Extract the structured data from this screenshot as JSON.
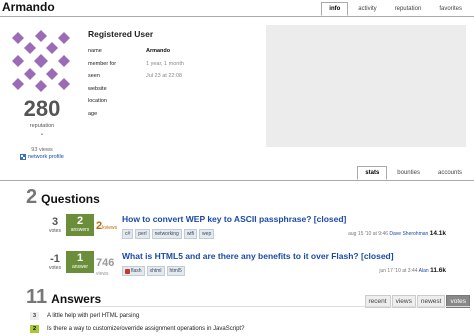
{
  "profile": {
    "name": "Armando",
    "registered": "Registered User",
    "reputation": "280",
    "reputation_label": "reputation",
    "rep_dot": "•",
    "views": "93 views",
    "network_profile": "network profile",
    "info": [
      {
        "key": "name",
        "value": "Armando",
        "bold": true
      },
      {
        "key": "member for",
        "value": "1 year, 1 month",
        "bold": false
      },
      {
        "key": "seen",
        "value": "Jul 23 at 22:08",
        "bold": false
      },
      {
        "key": "website",
        "value": "",
        "bold": false
      },
      {
        "key": "location",
        "value": "",
        "bold": false
      },
      {
        "key": "age",
        "value": "",
        "bold": false
      }
    ]
  },
  "top_tabs": [
    {
      "label": "info",
      "active": true
    },
    {
      "label": "activity",
      "active": false
    },
    {
      "label": "reputation",
      "active": false
    },
    {
      "label": "favorites",
      "active": false
    }
  ],
  "stats_tabs": [
    {
      "label": "stats",
      "active": true
    },
    {
      "label": "bounties",
      "active": false
    },
    {
      "label": "accounts",
      "active": false
    }
  ],
  "questions": {
    "count": "2",
    "label": "Questions",
    "items": [
      {
        "votes": "3",
        "votes_label": "votes",
        "answers": "2",
        "answers_label": "answers",
        "views": "2",
        "views_label": "kviews",
        "title": "How to convert WEP key to ASCII passphrase? [closed]",
        "tags": [
          "c#",
          "perl",
          "networking",
          "wifi",
          "wep"
        ],
        "date": "aug 15 '10 at 9:46",
        "user": "Dave Sherohman",
        "user_rep": "14.1k"
      },
      {
        "votes": "-1",
        "votes_label": "votes",
        "answers": "1",
        "answers_label": "answer",
        "views": "746",
        "views_label": "views",
        "title": "What is HTML5 and are there any benefits to it over Flash? [closed]",
        "tags": [
          "flash",
          "xhtml",
          "html5"
        ],
        "date": "jun 17 '10 at 3:44",
        "user": "Alan",
        "user_rep": "11.6k"
      }
    ]
  },
  "answers": {
    "count": "11",
    "label": "Answers",
    "sort_tabs": [
      {
        "label": "recent",
        "active": false
      },
      {
        "label": "views",
        "active": false
      },
      {
        "label": "newest",
        "active": false
      },
      {
        "label": "votes",
        "active": true
      }
    ],
    "items": [
      {
        "score": "3",
        "title": "A little help with perl HTML parsing",
        "accepted": false
      },
      {
        "score": "2",
        "title": "Is there a way to customize/override assignment operations in JavaScript?",
        "accepted": true
      }
    ]
  },
  "colors": {
    "accepted_answer": "#6b8e3b",
    "link": "#1a4aa8",
    "views_hot": "#c06b00",
    "avatar": "#9b6bb8"
  }
}
